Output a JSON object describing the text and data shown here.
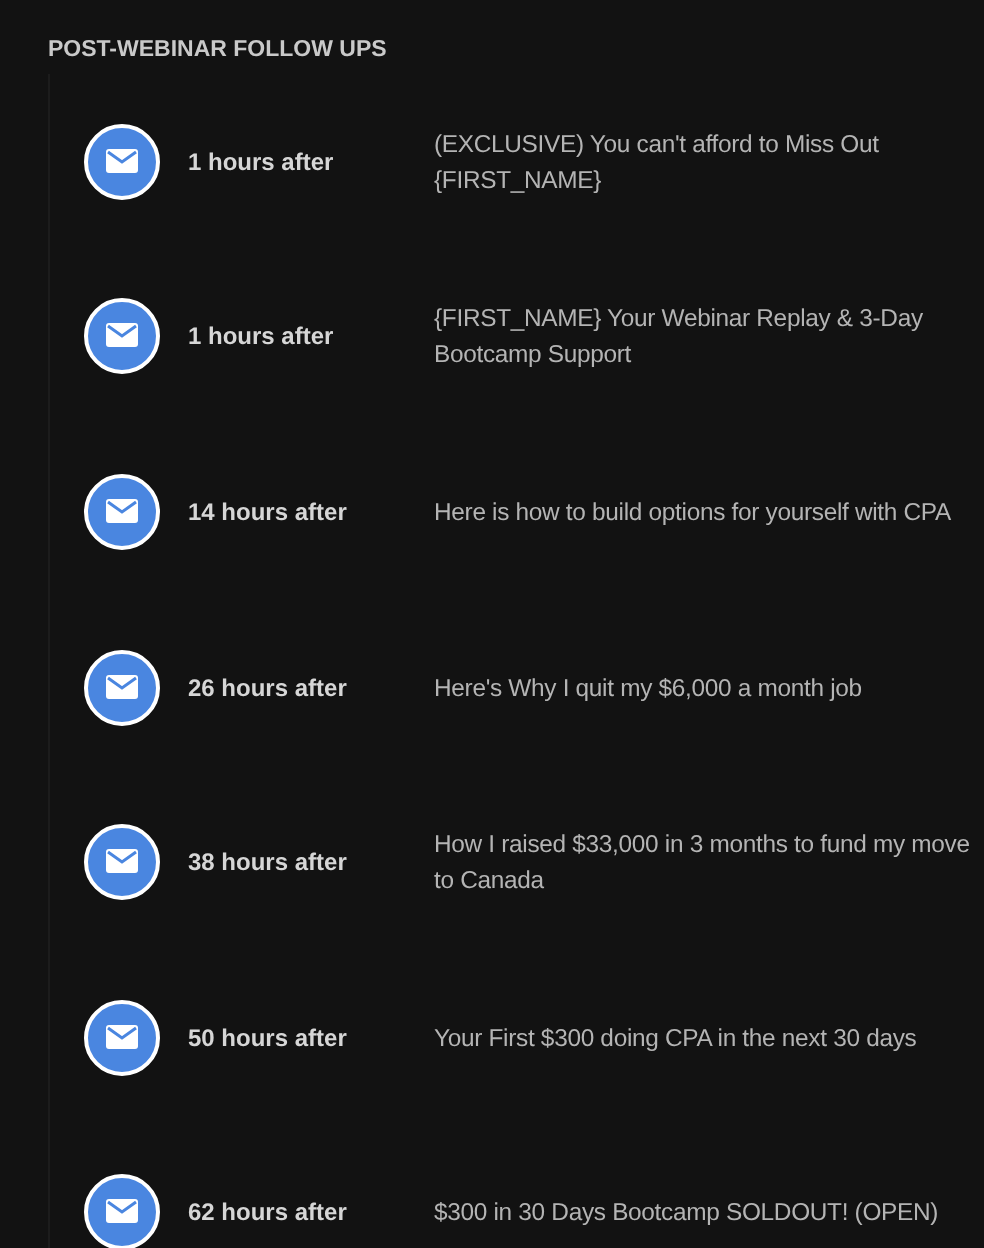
{
  "section": {
    "title": "POST-WEBINAR FOLLOW UPS"
  },
  "emails": [
    {
      "delay": "1 hours after",
      "subject": "(EXCLUSIVE) You can't afford to Miss Out {FIRST_NAME}"
    },
    {
      "delay": "1 hours after",
      "subject": "{FIRST_NAME} Your Webinar Replay & 3-Day Bootcamp Support"
    },
    {
      "delay": "14 hours after",
      "subject": "Here is how to build options for yourself with CPA"
    },
    {
      "delay": "26 hours after",
      "subject": "Here's Why I quit my $6,000 a month job"
    },
    {
      "delay": "38 hours after",
      "subject": "How I raised $33,000 in 3 months to fund my move to Canada"
    },
    {
      "delay": "50 hours after",
      "subject": "Your First $300 doing CPA in the next 30 days"
    },
    {
      "delay": "62 hours after",
      "subject": "$300 in 30 Days Bootcamp SOLDOUT! (OPEN)"
    }
  ]
}
